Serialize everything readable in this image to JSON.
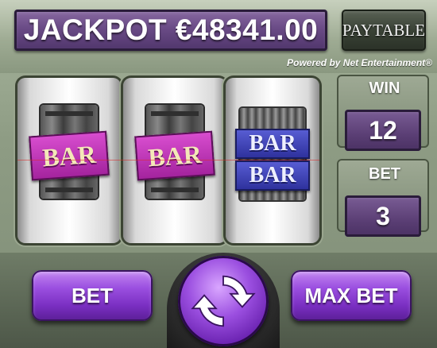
{
  "header": {
    "jackpot_text": "JACKPOT €48341.00",
    "paytable_label": "PAYTABLE",
    "powered_by": "Powered by Net Entertainment®"
  },
  "reels": [
    {
      "symbol": "single-bar",
      "label": "BAR"
    },
    {
      "symbol": "single-bar",
      "label": "BAR"
    },
    {
      "symbol": "double-bar",
      "labels": [
        "BAR",
        "BAR"
      ]
    }
  ],
  "side": {
    "win_label": "WIN",
    "win_value": "12",
    "bet_label": "BET",
    "bet_value": "3"
  },
  "controls": {
    "bet_label": "BET",
    "max_bet_label": "MAX BET",
    "spin_icon": "spin-arrows-icon"
  },
  "colors": {
    "accent_purple": "#9b4fe0",
    "bar_magenta": "#d94ed0",
    "bar_blue": "#2c2f9a",
    "panel_green": "#8e9c84"
  }
}
